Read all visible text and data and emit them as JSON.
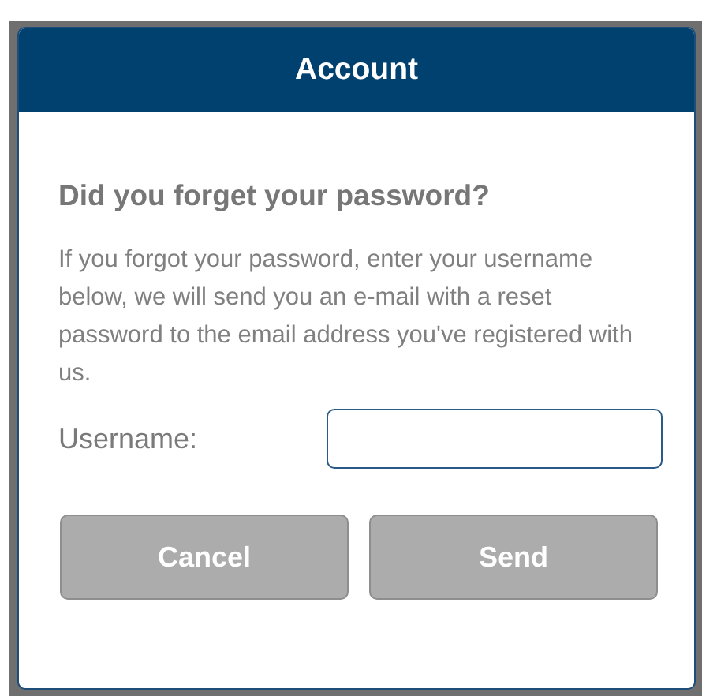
{
  "dialog": {
    "title": "Account",
    "heading": "Did you forget your password?",
    "message": "If you forgot your password, enter your username below, we will send you an e-mail with a reset password to the email address you've registered with us.",
    "username": {
      "label": "Username:"
    },
    "buttons": [
      {
        "label": "Cancel",
        "disabled": false
      },
      {
        "label": "Send",
        "disabled": false
      }
    ]
  }
}
